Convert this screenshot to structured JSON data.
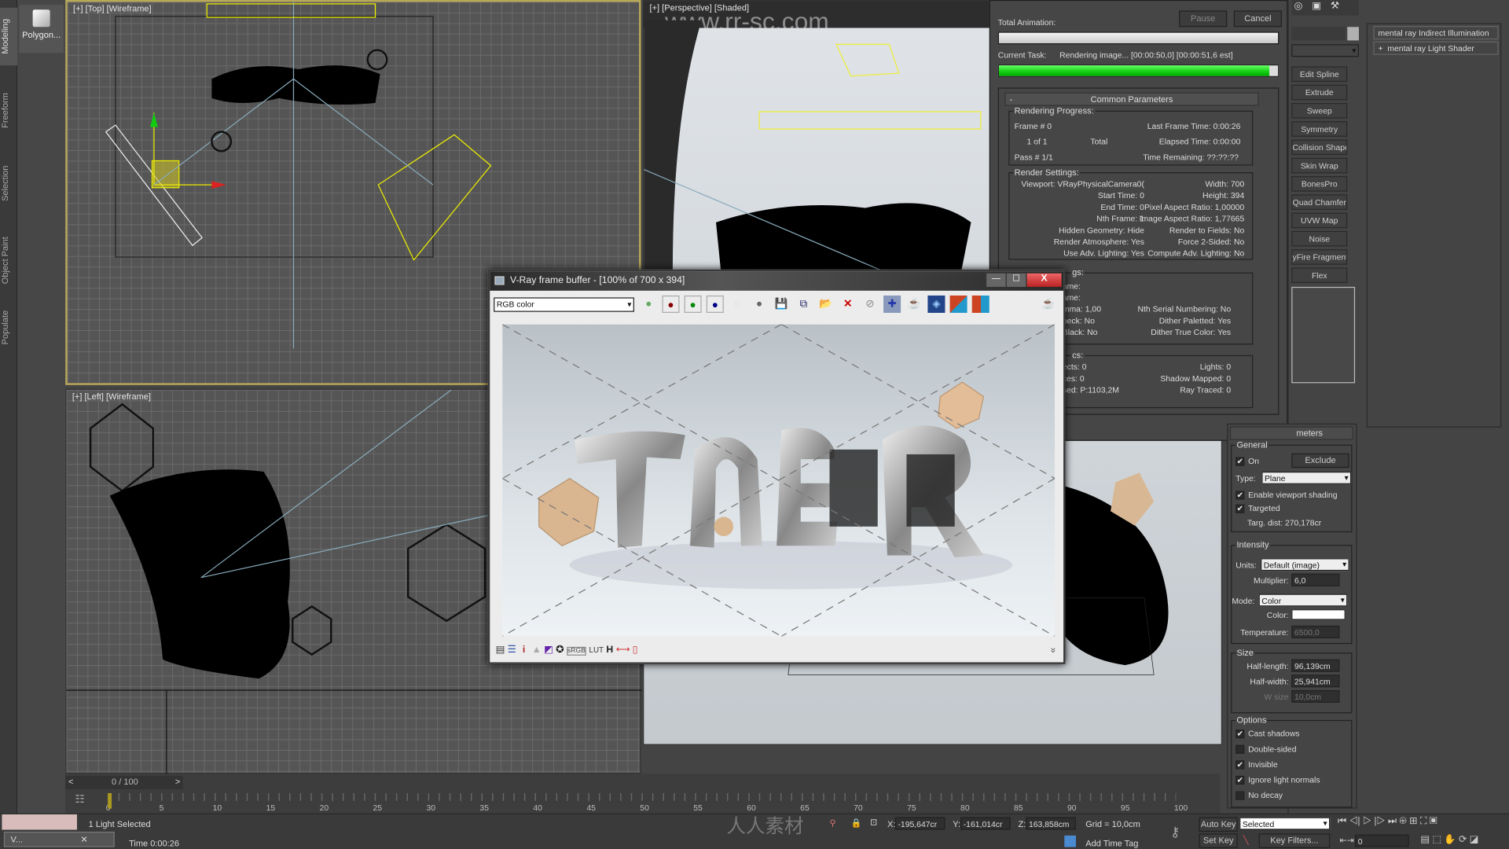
{
  "side_tabs": [
    "Modeling",
    "Freeform",
    "Selection",
    "Object Paint",
    "Populate"
  ],
  "polygon_label": "Polygon...",
  "viewports": {
    "top": "[+] [Top] [Wireframe]",
    "perspective": "[+] [Perspective] [Shaded]",
    "left": "[+] [Left] [Wireframe]"
  },
  "watermark": {
    "url": "www.rr-sc.com",
    "cn": "人人素材"
  },
  "render_dialog": {
    "total_animation_label": "Total Animation:",
    "pause": "Pause",
    "cancel": "Cancel",
    "current_task_label": "Current Task:",
    "current_task": "Rendering image... [00:00:50,0] [00:00:51,6 est]",
    "total_progress": 0,
    "task_progress": 97,
    "rollout_title": "Common Parameters",
    "rollout_toggle": "-",
    "progress_group": "Rendering Progress:",
    "frame": "Frame #  0",
    "of": "1 of 1",
    "total": "Total",
    "pass": "Pass #  1/1",
    "last_frame_time": "Last Frame Time:  0:00:26",
    "elapsed": "Elapsed Time:  0:00:00",
    "remaining": "Time Remaining: ??:??:??",
    "settings_group": "Render Settings:",
    "settings_left": [
      "Viewport: VRayPhysicalCamera0(",
      "Start Time: 0",
      "End Time: 0",
      "Nth Frame: 1",
      "Hidden Geometry: Hide",
      "Render Atmosphere: Yes",
      "Use Adv. Lighting: Yes"
    ],
    "settings_right": [
      "Width: 700",
      "Height: 394",
      "Pixel Aspect Ratio: 1,00000",
      "Image Aspect Ratio: 1,77665",
      "Render to Fields: No",
      "Force 2-Sided: No",
      "Compute Adv. Lighting: No"
    ],
    "output_group": "gs:",
    "output_left": [
      "ame:",
      "ame:",
      "mma: 1,00",
      "heck: No",
      "Black: No"
    ],
    "output_right": [
      "Nth Serial Numbering: No",
      "Dither Paletted: Yes",
      "Dither True Color: Yes"
    ],
    "stats_group": "cs:",
    "stats_left": [
      "ects: 0",
      "ces: 0",
      "sed: P:1103,2M"
    ],
    "stats_right": [
      "Lights: 0",
      "Shadow Mapped: 0",
      "Ray Traced: 0"
    ]
  },
  "modifiers": [
    "Edit Spline",
    "Extrude",
    "Sweep",
    "Symmetry",
    "Collision Shape",
    "Skin Wrap",
    "BonesPro",
    "Quad Chamfer",
    "UVW Map",
    "Noise",
    "yFire Fragment",
    "Flex"
  ],
  "rollouts": [
    "mental ray Indirect Illumination",
    "mental ray Light Shader"
  ],
  "rollout_plus": "+",
  "vfb": {
    "title": "V-Ray frame buffer - [100% of 700 x 394]",
    "channel": "RGB color",
    "min": "—",
    "max": "☐",
    "close": "X",
    "bottom_icons": [
      "i",
      "LUT",
      "H"
    ],
    "expand": "»"
  },
  "light_params": {
    "header": "meters",
    "general": "General",
    "on": "On",
    "on_checked": true,
    "exclude": "Exclude",
    "type_label": "Type:",
    "type": "Plane",
    "viewport_shading": "Enable viewport shading",
    "targeted": "Targeted",
    "targ_dist": "Targ. dist:  270,178cr",
    "intensity": "Intensity",
    "units_label": "Units:",
    "units": "Default (image)",
    "multiplier_label": "Multiplier:",
    "multiplier": "6,0",
    "mode_label": "Mode:",
    "mode": "Color",
    "color_label": "Color:",
    "color": "#ffffff",
    "temperature_label": "Temperature:",
    "temperature": "6500,0",
    "size": "Size",
    "half_length_label": "Half-length:",
    "half_length": "96,139cm",
    "half_width_label": "Half-width:",
    "half_width": "25,941cm",
    "w_size_label": "W size",
    "w_size": "10,0cm",
    "options": "Options",
    "opts": [
      {
        "label": "Cast shadows",
        "checked": true
      },
      {
        "label": "Double-sided",
        "checked": false
      },
      {
        "label": "Invisible",
        "checked": true
      },
      {
        "label": "Ignore light normals",
        "checked": true
      },
      {
        "label": "No decay",
        "checked": false
      }
    ]
  },
  "timeline": {
    "slider": "0 / 100",
    "prev": "<",
    "next": ">",
    "ticks": [
      "0",
      "5",
      "10",
      "15",
      "20",
      "25",
      "30",
      "35",
      "40",
      "45",
      "50",
      "55",
      "60",
      "65",
      "70",
      "75",
      "80",
      "85",
      "90",
      "95",
      "100"
    ]
  },
  "status": {
    "selected": "1 Light Selected",
    "render_time": "Time  0:00:26",
    "task_item": "V...",
    "x_label": "X:",
    "x": "-195,647cr",
    "y_label": "Y:",
    "y": "-161,014cr",
    "z_label": "Z:",
    "z": "163,858cm",
    "grid": "Grid = 10,0cm",
    "add_time_tag": "Add Time Tag",
    "auto_key": "Auto Key",
    "set_key": "Set Key",
    "key_mode": "Selected",
    "key_filters": "Key Filters...",
    "frame": "0"
  }
}
